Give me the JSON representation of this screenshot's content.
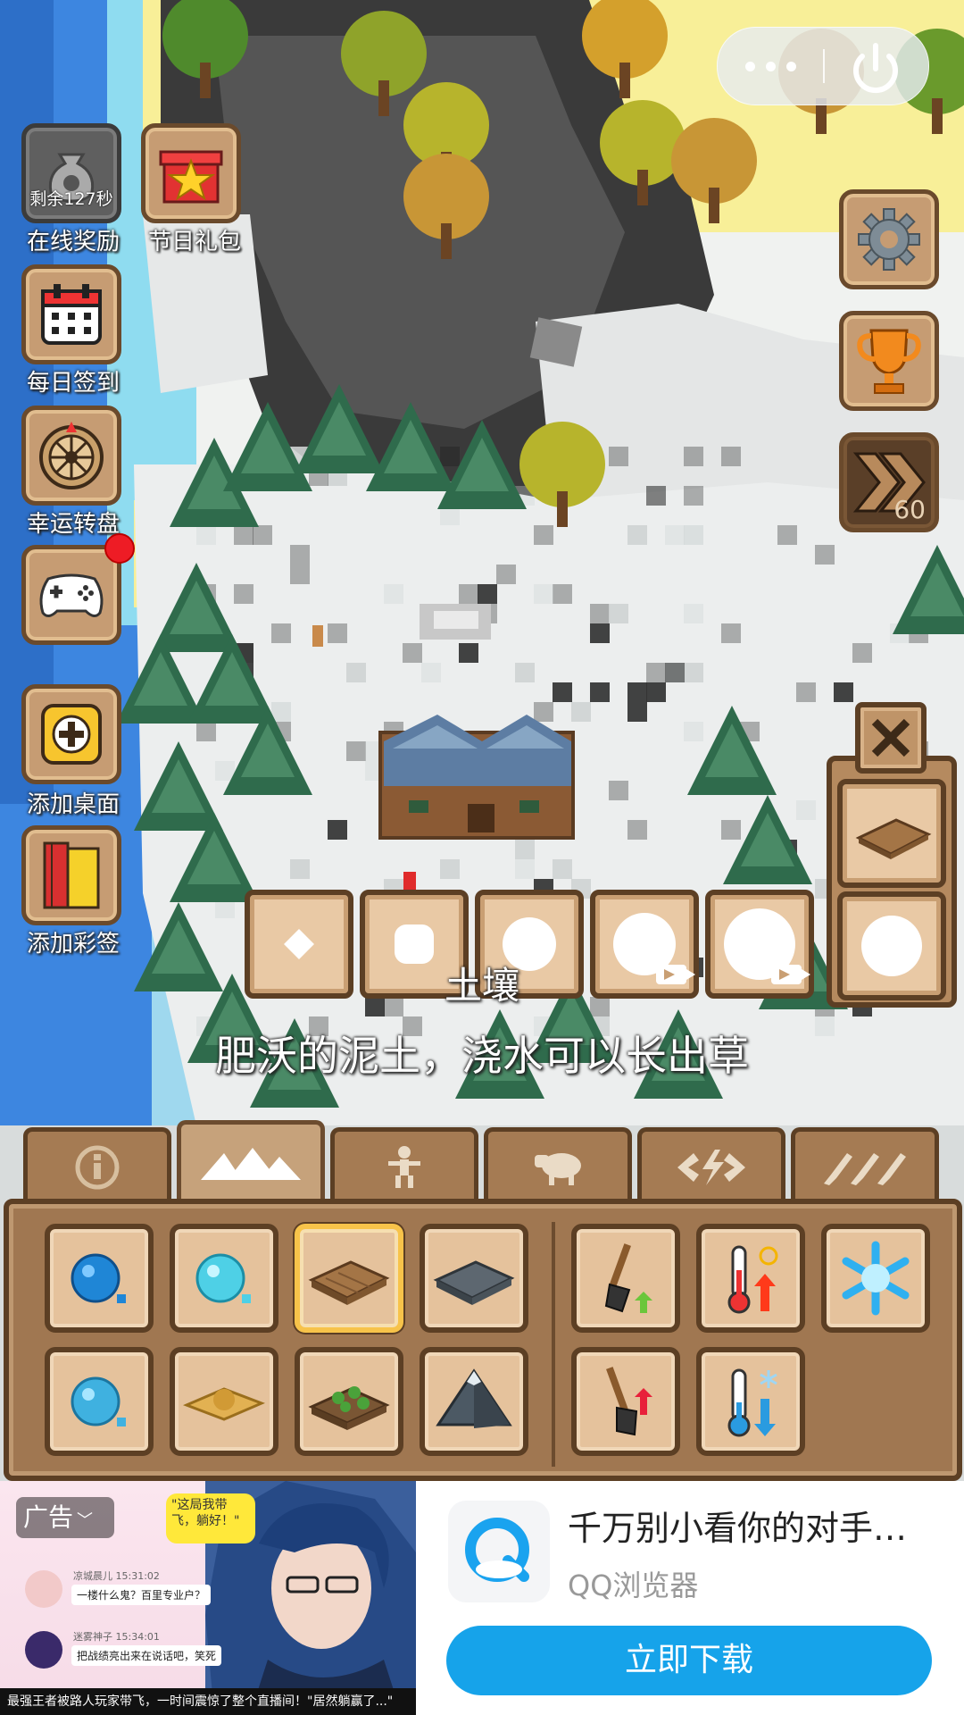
{
  "capsule": {
    "more_icon": "more-dots-icon",
    "power_icon": "power-icon"
  },
  "left_menu": {
    "online_reward": {
      "timer": "剩余127秒",
      "label": "在线奖励",
      "icon": "money-bag-icon"
    },
    "holiday_gift": {
      "label": "节日礼包",
      "icon": "gift-box-icon"
    },
    "daily_checkin": {
      "label": "每日签到",
      "icon": "calendar-icon"
    },
    "lucky_wheel": {
      "label": "幸运转盘",
      "icon": "wheel-icon"
    },
    "games": {
      "label": "",
      "icon": "gamepad-icon",
      "badge": true
    },
    "add_desktop": {
      "label": "添加桌面",
      "icon": "plus-icon"
    },
    "add_tag": {
      "label": "添加彩签",
      "icon": "bookmark-icon"
    }
  },
  "right_menu": {
    "settings": {
      "icon": "gear-icon"
    },
    "achievements": {
      "icon": "trophy-icon"
    },
    "speed": {
      "icon": "fast-forward-icon",
      "value": "60"
    }
  },
  "brush": {
    "sizes": [
      "1",
      "2",
      "3",
      "4",
      "5"
    ],
    "video_unlock_slots": [
      4,
      5
    ]
  },
  "info": {
    "title": "土壤",
    "description": "肥沃的泥土，浇水可以长出草"
  },
  "tabs": [
    {
      "id": "info",
      "icon": "info-icon"
    },
    {
      "id": "terrain",
      "icon": "mountains-icon",
      "active": true
    },
    {
      "id": "people",
      "icon": "person-icon"
    },
    {
      "id": "animals",
      "icon": "sheep-icon"
    },
    {
      "id": "disasters",
      "icon": "lightning-icon"
    },
    {
      "id": "tools",
      "icon": "brushes-icon"
    }
  ],
  "tools": [
    {
      "name": "deep-water-icon"
    },
    {
      "name": "shallow-water-icon"
    },
    {
      "name": "soil-tile-icon",
      "selected": true
    },
    {
      "name": "rock-tile-icon"
    },
    {
      "name": "lake-water-icon"
    },
    {
      "name": "sand-tile-icon"
    },
    {
      "name": "grass-tile-icon"
    },
    {
      "name": "mountain-tile-icon"
    },
    {
      "name": "shovel-raise-icon"
    },
    {
      "name": "heat-up-icon"
    },
    {
      "name": "freeze-icon"
    },
    {
      "name": "shovel-lower-icon"
    },
    {
      "name": "cool-down-icon"
    }
  ],
  "ad": {
    "tag": "广告",
    "bubble": "\"这局我带飞，躺好！\"",
    "chat": [
      {
        "name": "凉城晨儿  15:31:02",
        "msg": "一楼什么鬼？百里专业户？"
      },
      {
        "name": "迷雾神子  15:34:01",
        "msg": "把战绩亮出来在说话吧，笑死"
      }
    ],
    "caption": "最强王者被路人玩家带飞，一时间震惊了整个直播间！\"居然躺赢了...\"",
    "title": "千万别小看你的对手…",
    "app_name": "QQ浏览器",
    "button": "立即下载"
  }
}
